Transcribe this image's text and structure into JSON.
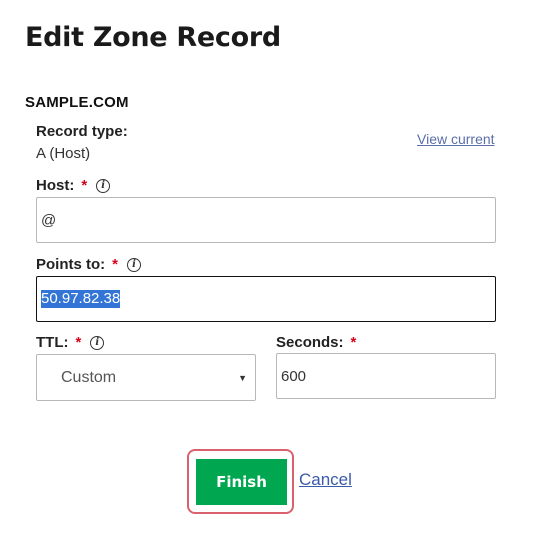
{
  "page": {
    "title": "Edit Zone Record",
    "domain": "SAMPLE.COM"
  },
  "record_type": {
    "label": "Record type:",
    "value": "A (Host)",
    "view_current": "View current"
  },
  "host": {
    "label": "Host:",
    "required_mark": "*",
    "value": "@"
  },
  "points_to": {
    "label": "Points to:",
    "required_mark": "*",
    "value": "50.97.82.38"
  },
  "ttl": {
    "label": "TTL:",
    "required_mark": "*",
    "selected": "Custom"
  },
  "seconds": {
    "label": "Seconds:",
    "required_mark": "*",
    "value": "600"
  },
  "actions": {
    "finish": "Finish",
    "cancel": "Cancel"
  },
  "colors": {
    "finish_green": "#00a650",
    "required_red": "#d6001c",
    "link_blue": "#3b5ba8",
    "focus_outline": "#d9626e",
    "selection_blue": "#3375d6"
  },
  "icons": {
    "info": "info-icon",
    "dropdown": "chevron-down-icon"
  }
}
